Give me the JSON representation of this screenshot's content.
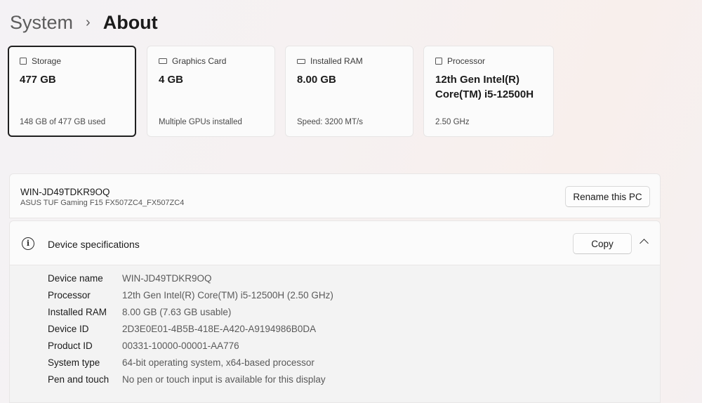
{
  "breadcrumb": {
    "parent": "System",
    "separator": "›",
    "current": "About"
  },
  "cards": [
    {
      "icon": "storage-icon",
      "label": "Storage",
      "value": "477 GB",
      "sub": "148 GB of 477 GB used"
    },
    {
      "icon": "graphics-card-icon",
      "label": "Graphics Card",
      "value": "4 GB",
      "sub": "Multiple GPUs installed"
    },
    {
      "icon": "ram-icon",
      "label": "Installed RAM",
      "value": "8.00 GB",
      "sub": "Speed: 3200 MT/s"
    },
    {
      "icon": "processor-icon",
      "label": "Processor",
      "value": "12th Gen Intel(R) Core(TM) i5-12500H",
      "sub": "2.50 GHz"
    }
  ],
  "pc": {
    "name": "WIN-JD49TDKR9OQ",
    "model": "ASUS TUF Gaming F15 FX507ZC4_FX507ZC4",
    "rename_label": "Rename this PC"
  },
  "specs": {
    "title": "Device specifications",
    "copy_label": "Copy",
    "rows": [
      {
        "label": "Device name",
        "value": "WIN-JD49TDKR9OQ"
      },
      {
        "label": "Processor",
        "value": "12th Gen Intel(R) Core(TM) i5-12500H (2.50 GHz)"
      },
      {
        "label": "Installed RAM",
        "value": "8.00 GB (7.63 GB usable)"
      },
      {
        "label": "Device ID",
        "value": "2D3E0E01-4B5B-418E-A420-A9194986B0DA"
      },
      {
        "label": "Product ID",
        "value": "00331-10000-00001-AA776"
      },
      {
        "label": "System type",
        "value": "64-bit operating system, x64-based processor"
      },
      {
        "label": "Pen and touch",
        "value": "No pen or touch input is available for this display"
      }
    ]
  }
}
